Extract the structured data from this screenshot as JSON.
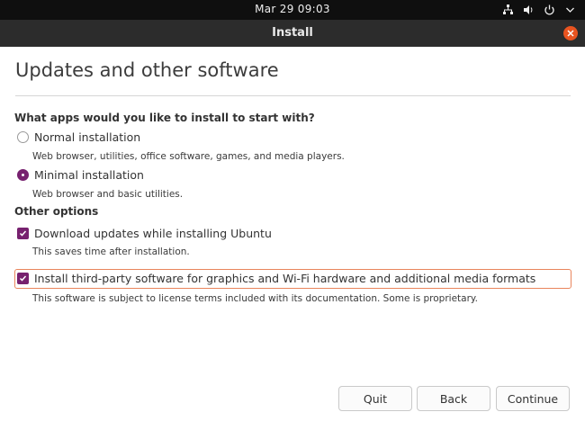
{
  "topbar": {
    "clock": "Mar 29  09:03",
    "icons": [
      "network-icon",
      "volume-icon",
      "power-icon",
      "chevron-down-icon"
    ]
  },
  "window": {
    "title": "Install"
  },
  "page": {
    "title": "Updates and other software"
  },
  "apps_question": {
    "heading": "What apps would you like to install to start with?",
    "options": [
      {
        "label": "Normal installation",
        "description": "Web browser, utilities, office software, games, and media players.",
        "selected": false
      },
      {
        "label": "Minimal installation",
        "description": "Web browser and basic utilities.",
        "selected": true
      }
    ]
  },
  "other_options": {
    "heading": "Other options",
    "items": [
      {
        "label": "Download updates while installing Ubuntu",
        "description": "This saves time after installation.",
        "checked": true
      },
      {
        "label": "Install third-party software for graphics and Wi-Fi hardware and additional media formats",
        "description": "This software is subject to license terms included with its documentation. Some is proprietary.",
        "checked": true
      }
    ]
  },
  "buttons": {
    "quit": "Quit",
    "back": "Back",
    "continue": "Continue"
  },
  "colors": {
    "accent": "#77216f",
    "close": "#e95420",
    "focus_border": "#e9855c"
  }
}
